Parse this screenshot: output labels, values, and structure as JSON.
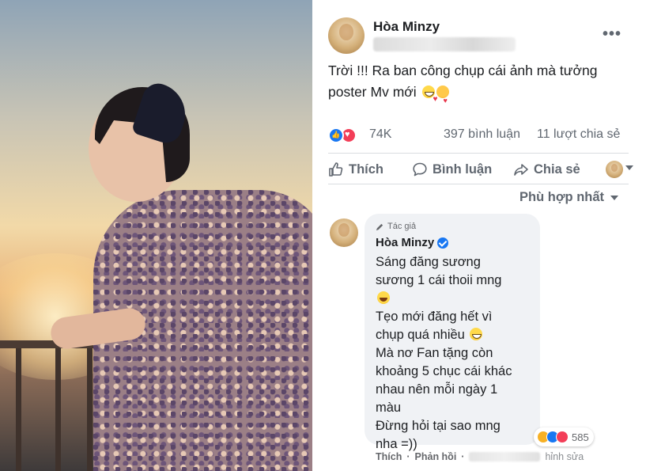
{
  "post": {
    "author": "Hòa Minzy",
    "text_line1": "Trời !!! Ra ban công chụp cái ảnh mà tưởng",
    "text_line2": "poster Mv mới",
    "reaction_count": "74K",
    "comment_count": "397 bình luận",
    "share_count": "11 lượt chia sẻ"
  },
  "actions": {
    "like": "Thích",
    "comment": "Bình luận",
    "share": "Chia sẻ"
  },
  "sort": {
    "label": "Phù hợp nhất"
  },
  "comment": {
    "badge": "Tác giả",
    "author": "Hòa Minzy",
    "lines": [
      "Sáng đăng sương",
      "sương 1 cái thoii mng",
      "Tẹo mới đăng hết vì",
      "chụp quá nhiều",
      "Mà nơ Fan tặng còn",
      "khoảng 5 chục cái khác",
      "nhau nên mỗi ngày 1",
      "màu",
      "Đừng hỏi tại sao mng",
      "nha =))"
    ],
    "reaction_count": "585",
    "footer_like": "Thích",
    "footer_reply": "Phản hồi",
    "footer_sep": "·",
    "footer_edited": "hỉnh sửa"
  },
  "icons": {
    "more": "more-horizontal-icon",
    "like": "thumbs-up-icon",
    "comment": "comment-bubble-icon",
    "share": "share-arrow-icon"
  },
  "colors": {
    "facebook_blue": "#1877f2",
    "love_red": "#f33e58",
    "haha_yellow": "#f7b125",
    "meta_gray": "#606770"
  }
}
